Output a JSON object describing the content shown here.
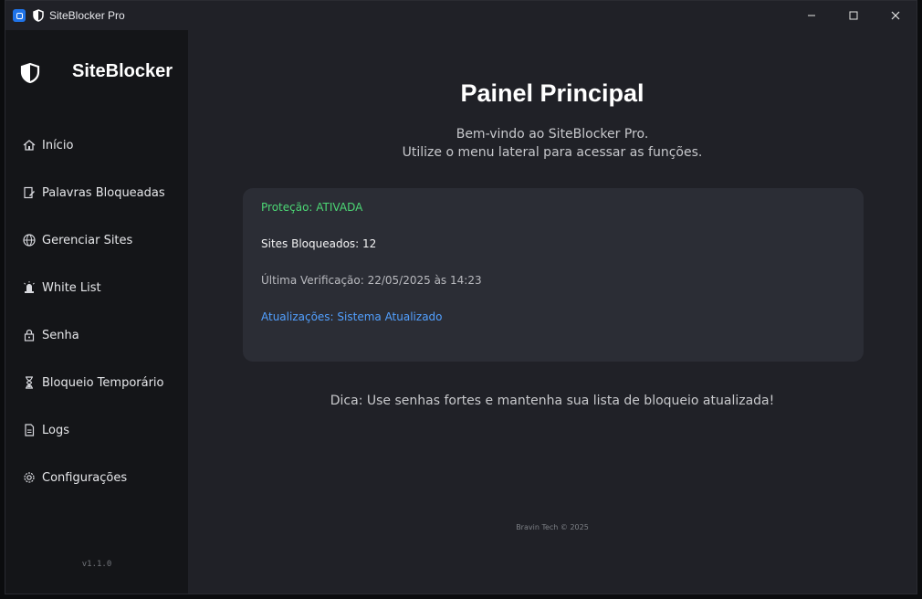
{
  "window": {
    "title": "SiteBlocker Pro",
    "controls": {
      "minimize_icon": "minimize-icon",
      "maximize_icon": "maximize-icon",
      "close_icon": "close-icon"
    }
  },
  "sidebar": {
    "brand_name": "SiteBlocker",
    "brand_icon": "shield-icon",
    "items": [
      {
        "label": "Início",
        "icon": "home-icon"
      },
      {
        "label": "Palavras Bloqueadas",
        "icon": "edit-icon"
      },
      {
        "label": "Gerenciar Sites",
        "icon": "globe-icon"
      },
      {
        "label": "White List",
        "icon": "alarm-icon"
      },
      {
        "label": "Senha",
        "icon": "lock-icon"
      },
      {
        "label": "Bloqueio Temporário",
        "icon": "hourglass-icon"
      },
      {
        "label": "Logs",
        "icon": "document-icon"
      },
      {
        "label": "Configurações",
        "icon": "gear-icon"
      }
    ],
    "version": "v1.1.0"
  },
  "main": {
    "title": "Painel Principal",
    "welcome_line1": "Bem-vindo ao SiteBlocker Pro.",
    "welcome_line2": "Utilize o menu lateral para acessar as funções.",
    "status": {
      "protection": "Proteção: ATIVADA",
      "sites": "Sites Bloqueados: 12",
      "last_check": "Última Verificação: 22/05/2025 às 14:23",
      "updates": "Atualizações: Sistema Atualizado"
    },
    "tip": "Dica: Use senhas fortes e mantenha sua lista de bloqueio atualizada!",
    "footer": "Bravin Tech © 2025"
  },
  "colors": {
    "accent": "#1f73e8",
    "status_active": "#4cd775",
    "status_update": "#52a0ff",
    "sidebar_bg": "#141518",
    "main_bg": "#202127",
    "card_bg": "#2b2d35"
  }
}
